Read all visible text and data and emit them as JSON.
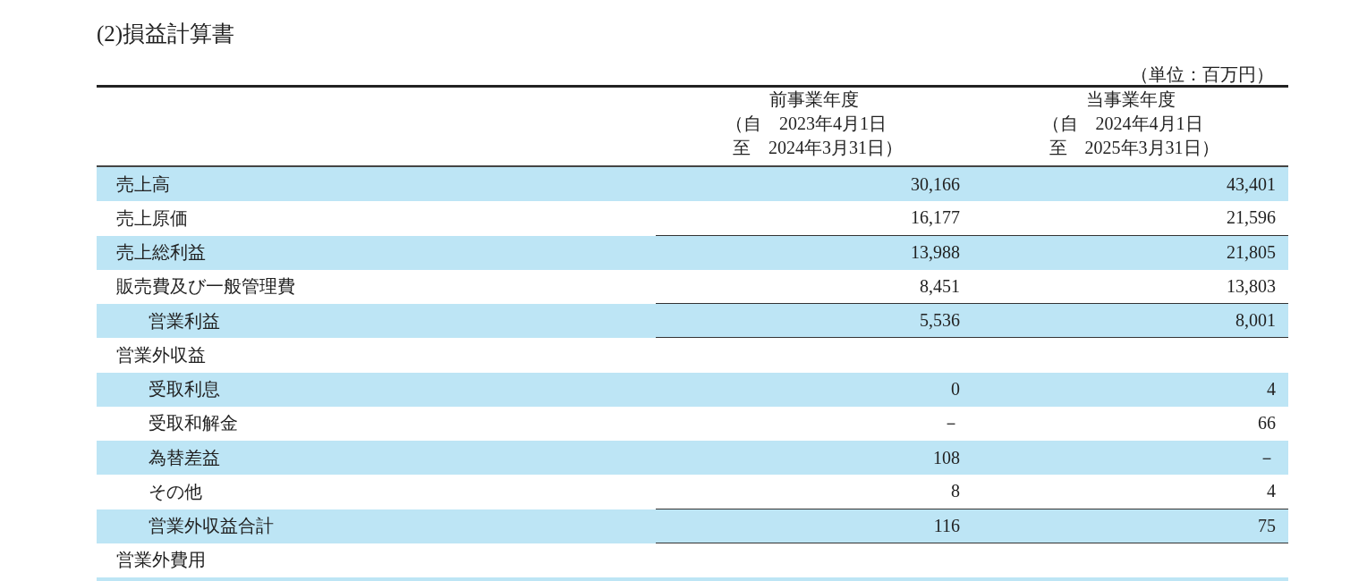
{
  "title": "(2)損益計算書",
  "unit": "（単位：百万円）",
  "columns": [
    {
      "lines": [
        "前事業年度",
        "（自　2023年4月1日",
        "至　2024年3月31日）"
      ]
    },
    {
      "lines": [
        "当事業年度",
        "（自　2024年4月1日",
        "至　2025年3月31日）"
      ]
    }
  ],
  "rows": [
    {
      "label": "売上高",
      "kind": "item",
      "shaded": true,
      "rule_below": false,
      "values": [
        "30,166",
        "43,401"
      ]
    },
    {
      "label": "売上原価",
      "kind": "item",
      "shaded": false,
      "rule_below": true,
      "values": [
        "16,177",
        "21,596"
      ]
    },
    {
      "label": "売上総利益",
      "kind": "item",
      "shaded": true,
      "rule_below": false,
      "values": [
        "13,988",
        "21,805"
      ]
    },
    {
      "label": "販売費及び一般管理費",
      "kind": "item",
      "shaded": false,
      "rule_below": true,
      "values": [
        "8,451",
        "13,803"
      ]
    },
    {
      "label": "営業利益",
      "kind": "subtotal",
      "shaded": true,
      "rule_below": true,
      "values": [
        "5,536",
        "8,001"
      ]
    },
    {
      "label": "営業外収益",
      "kind": "item",
      "shaded": false,
      "rule_below": false,
      "children": [
        {
          "label": "受取利息",
          "shaded": true,
          "rule_below": false,
          "values": [
            "0",
            "4"
          ]
        },
        {
          "label": "受取和解金",
          "shaded": false,
          "rule_below": false,
          "values": [
            "－",
            "66"
          ]
        },
        {
          "label": "為替差益",
          "shaded": true,
          "rule_below": false,
          "values": [
            "108",
            "－"
          ]
        },
        {
          "label": "その他",
          "shaded": false,
          "rule_below": true,
          "values": [
            "8",
            "4"
          ]
        },
        {
          "label": "営業外収益合計",
          "shaded": true,
          "rule_below": true,
          "values": [
            "116",
            "75"
          ]
        }
      ]
    },
    {
      "label": "営業外費用",
      "kind": "item",
      "shaded": false,
      "rule_below": false
    }
  ]
}
